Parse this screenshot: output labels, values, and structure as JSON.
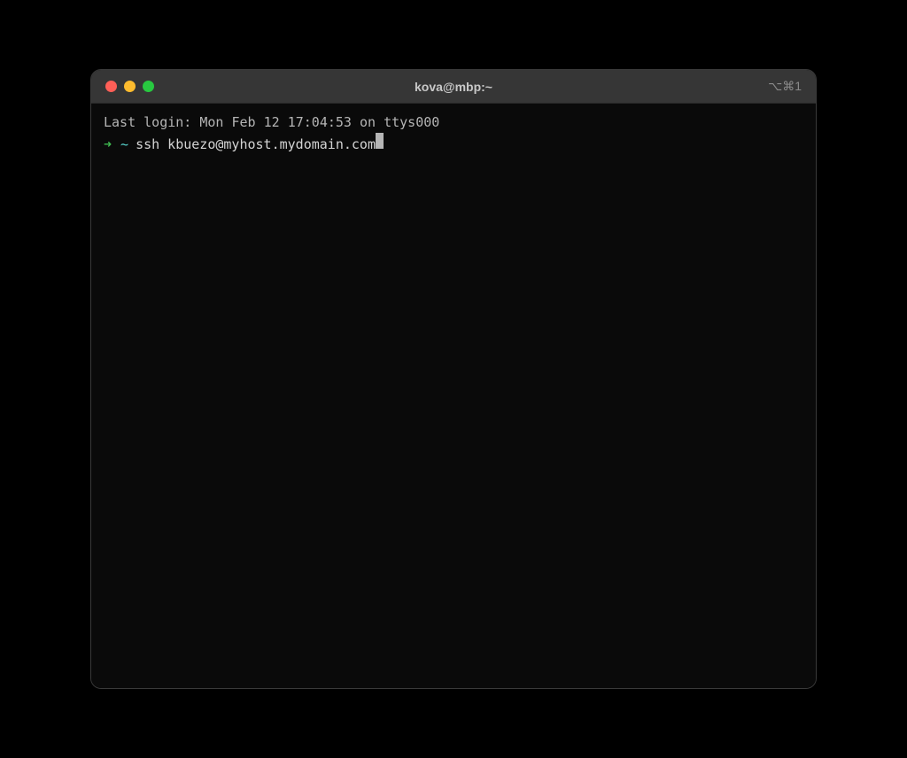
{
  "window": {
    "title": "kova@mbp:~",
    "shortcut": "⌥⌘1"
  },
  "terminal": {
    "last_login": "Last login: Mon Feb 12 17:04:53 on ttys000",
    "prompt": {
      "arrow": "➜",
      "cwd": "~",
      "command": "ssh kbuezo@myhost.mydomain.com"
    }
  }
}
